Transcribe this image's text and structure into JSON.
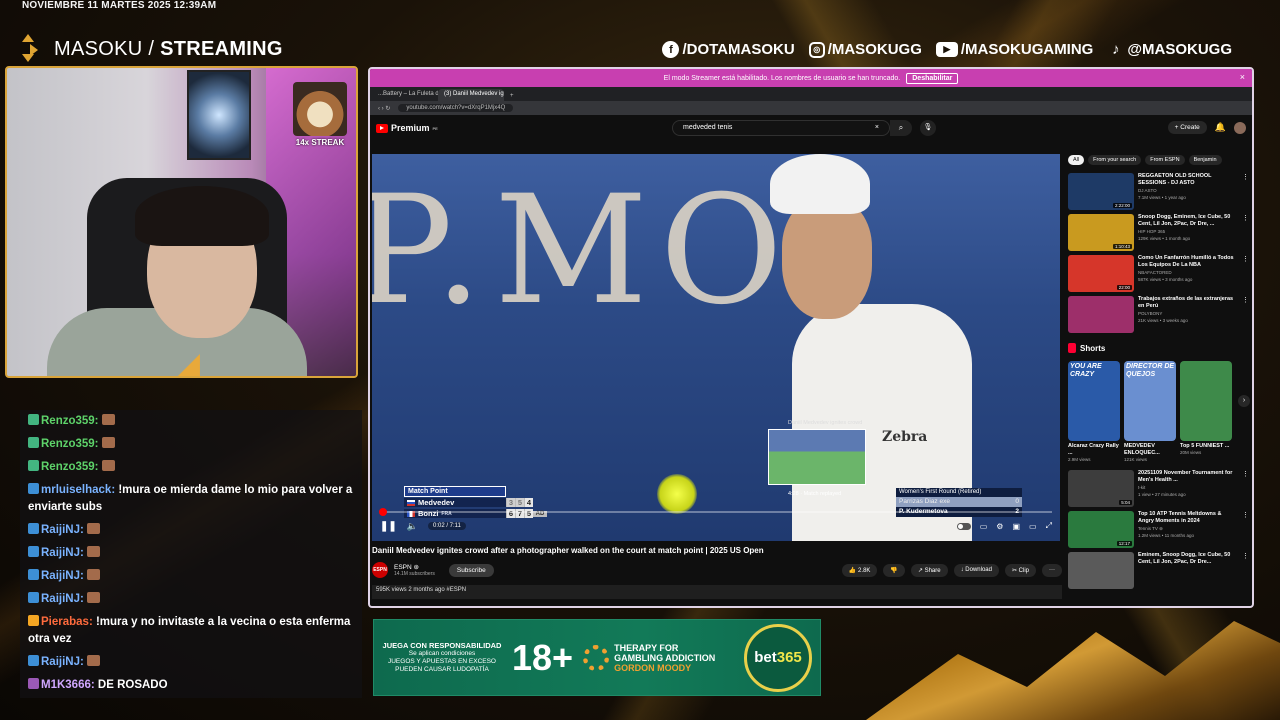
{
  "overlay": {
    "datetime": "NOVIEMBRE 11 MARTES 2025 12:39AM",
    "brand_name": "MASOKU",
    "brand_suffix": "STREAMING",
    "socials": [
      {
        "icon": "facebook-icon",
        "glyph": "f",
        "label": "/DOTAMASOKU"
      },
      {
        "icon": "instagram-icon",
        "glyph": "◎",
        "label": "/MASOKUGG"
      },
      {
        "icon": "youtube-icon",
        "glyph": "▶",
        "label": "/MASOKUGAMING"
      },
      {
        "icon": "tiktok-icon",
        "glyph": "♪",
        "label": "@MASOKUGG"
      }
    ],
    "streak_label": "14x STREAK"
  },
  "chat": {
    "messages": [
      {
        "user": "Renzo359:",
        "text": "",
        "color": "green"
      },
      {
        "user": "Renzo359:",
        "text": "",
        "color": "green"
      },
      {
        "user": "Renzo359:",
        "text": "",
        "color": "green"
      },
      {
        "user": "mrluiselhack:",
        "text": " !mura oe mierda dame lo mio para volver a enviarte subs",
        "color": "blue"
      },
      {
        "user": "RaijiNJ:",
        "text": "",
        "color": "blue"
      },
      {
        "user": "RaijiNJ:",
        "text": "",
        "color": "blue"
      },
      {
        "user": "RaijiNJ:",
        "text": "",
        "color": "blue"
      },
      {
        "user": "RaijiNJ:",
        "text": "",
        "color": "blue"
      },
      {
        "user": "Pierabas:",
        "text": " !mura y no invitaste a la vecina o esta enferma otra vez",
        "color": "orange"
      },
      {
        "user": "RaijiNJ:",
        "text": "",
        "color": "blue"
      },
      {
        "user": "M1K3666:",
        "text": " DE ROSADO",
        "color": "purple"
      }
    ]
  },
  "browser": {
    "streamer_notice": "El modo Streamer está habilitado. Los nombres de usuario se han truncado.",
    "streamer_disable": "Deshabilitar",
    "close_glyph": "×",
    "tabs": [
      "...Battery – La Fuleta de la T...",
      "(3) Daniil Medvedev ignite..."
    ],
    "tab_plus": "+",
    "url": "youtube.com/watch?v=dXrqP1Mjx4Q"
  },
  "youtube": {
    "logo": "Premium",
    "logo_sup": "PE",
    "search_value": "medveded tenis",
    "search_clear": "×",
    "search_button": "⌕",
    "mic_glyph": "🎙",
    "create_label": "+ Create",
    "player": {
      "banner_text": "P.MO",
      "zebra": "Zebra",
      "preview_title": "Daniil Medvedev ignites crowd",
      "preview_time": "4:28 · Match replayed",
      "score_header": "Match Point",
      "player1": {
        "name": "Medvedev",
        "country": "",
        "sets": [
          "3",
          "5",
          "4"
        ]
      },
      "player2": {
        "name": "Bonzi",
        "country": "FRA",
        "sets": [
          "6",
          "7",
          "5"
        ],
        "game": "AD"
      },
      "right_header": "Women's First Round (Retired)",
      "right_row1": {
        "name": "Parrizas Diaz exe",
        "score": "0"
      },
      "right_row2": {
        "name": "P. Kudermetova",
        "score": "2"
      },
      "time": "0:02 / 7:11",
      "progress": 0.005
    },
    "video_title": "Daniil Medvedev ignites crowd after a photographer walked on the court at match point | 2025 US Open",
    "channel": {
      "name": "ESPN ⊛",
      "subs": "14.1M subscribers",
      "avatar": "ESPN",
      "subscribe": "Subscribe"
    },
    "actions": [
      "👍 2.8K",
      "👎",
      "↗ Share",
      "↓ Download",
      "✂ Clip",
      "···"
    ],
    "meta": "595K views  2 months ago  #ESPN",
    "chips": [
      "All",
      "From your search",
      "From ESPN",
      "Benjamin"
    ],
    "related": [
      {
        "title": "REGGAETON OLD SCHOOL SESSIONS - DJ ASTO",
        "channel": "DJ ASTO",
        "meta": "7.1M views • 1 year ago",
        "duration": "2:22:00",
        "color": "#1e3a66"
      },
      {
        "title": "Snoop Dogg, Eminem, Ice Cube, 50 Cent, Lil Jon, 2Pac, Dr Dre, ...",
        "channel": "HIP HOP 365",
        "meta": "129K views • 1 month ago",
        "duration": "1:10:43",
        "color": "#c99a1f"
      },
      {
        "title": "Como Un Fanfarrón Humilló a Todos Los Equipos De La NBA",
        "channel": "NBAFACTORED",
        "meta": "587K views • 3 months ago",
        "duration": "22:00",
        "color": "#d6362a"
      },
      {
        "title": "Trabajos extraños de las extranjeras en Perú",
        "channel": "POLYBONY",
        "meta": "21K views • 3 weeks ago",
        "duration": "",
        "color": "#9d2f6a"
      }
    ],
    "shorts_label": "Shorts",
    "shorts": [
      {
        "title": "Alcaraz Crazy Rally ...",
        "views": "2.9M views",
        "overlay": "YOU ARE CRAZY",
        "color": "#2a5aa8"
      },
      {
        "title": "MEDVEDEV ENLOQUEC...",
        "views": "121K views",
        "overlay": "DIRECTOR DE QUEJOS",
        "color": "#6a8fd0"
      },
      {
        "title": "Top 5 FUNNIEST ...",
        "views": "20M views",
        "overlay": "",
        "color": "#3e8a4a"
      }
    ],
    "related2": [
      {
        "title": "20251109 November Tournament for Men's Health ...",
        "channel": "t-kit",
        "meta": "1 view • 27 minutes ago",
        "duration": "5:04",
        "color": "#3d3d3d"
      },
      {
        "title": "Top 10 ATP Tennis Meltdowns & Angry Moments in 2024",
        "channel": "Tennis TV ⊛",
        "meta": "1.2M views • 11 months ago",
        "duration": "12:17",
        "color": "#2a7a3e"
      },
      {
        "title": "Eminem, Snoop Dogg, Ice Cube, 50 Cent, Lil Jon, 2Pac, Dr Dre...",
        "channel": "",
        "meta": "",
        "duration": "",
        "color": "#5a5a5a"
      }
    ]
  },
  "ad": {
    "line1": "JUEGA CON RESPONSABILIDAD",
    "line2": "Se aplican condiciones",
    "line3": "JUEGOS Y APUESTAS EN EXCESO",
    "line4": "PUEDEN CAUSAR LUDOPATÍA",
    "age": "18+",
    "therapy1": "THERAPY FOR",
    "therapy2": "GAMBLING ADDICTION",
    "therapy3": "GORDON MOODY",
    "brand_a": "bet",
    "brand_b": "365"
  }
}
